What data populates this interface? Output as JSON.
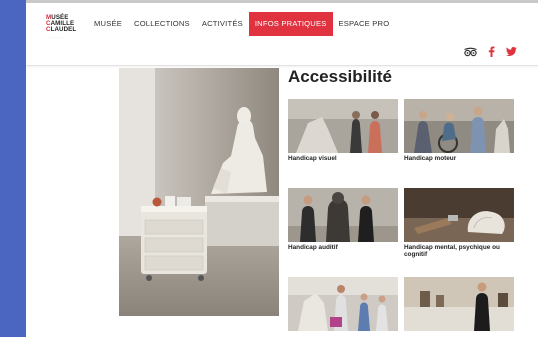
{
  "logo": {
    "lines": [
      "MUSÉE",
      "CAMILLE",
      "CLAUDEL"
    ],
    "first_letters": [
      "M",
      "C",
      "C"
    ],
    "line_rests": [
      "USÉE",
      "AMILLE",
      "LAUDEL"
    ]
  },
  "nav": {
    "items": [
      "MUSÉE",
      "COLLECTIONS",
      "ACTIVITÉS",
      "INFOS PRATIQUES",
      "ESPACE PRO"
    ],
    "active_index": 3
  },
  "social": [
    "tripadvisor-icon",
    "facebook-icon",
    "twitter-icon"
  ],
  "colors": {
    "accent": "#e0333f",
    "page_bg": "#4a66c0",
    "text": "#222222"
  },
  "page": {
    "title": "Accessibilité"
  },
  "tiles": [
    {
      "caption": "Handicap visuel"
    },
    {
      "caption": "Handicap moteur"
    },
    {
      "caption": "Handicap auditif"
    },
    {
      "caption": "Handicap mental, psychique ou cognitif"
    },
    {
      "caption": ""
    },
    {
      "caption": ""
    }
  ]
}
